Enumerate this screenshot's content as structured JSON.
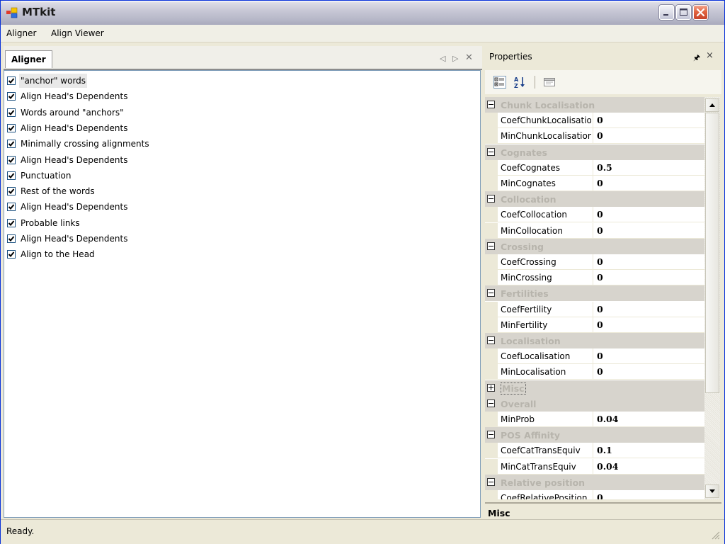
{
  "window": {
    "title": "MTkit"
  },
  "menu": {
    "items": [
      "Aligner",
      "Align Viewer"
    ]
  },
  "left_panel": {
    "tab_label": "Aligner",
    "steps": [
      {
        "label": "\"anchor\" words",
        "checked": true
      },
      {
        "label": "Align Head's Dependents",
        "checked": true
      },
      {
        "label": "Words around \"anchors\"",
        "checked": true
      },
      {
        "label": "Align Head's Dependents",
        "checked": true
      },
      {
        "label": "Minimally crossing alignments",
        "checked": true
      },
      {
        "label": "Align Head's Dependents",
        "checked": true
      },
      {
        "label": "Punctuation",
        "checked": true
      },
      {
        "label": "Rest of the words",
        "checked": true
      },
      {
        "label": "Align Head's Dependents",
        "checked": true
      },
      {
        "label": "Probable links",
        "checked": true
      },
      {
        "label": "Align Head's Dependents",
        "checked": true
      },
      {
        "label": "Align to the Head",
        "checked": true
      }
    ]
  },
  "properties": {
    "title": "Properties",
    "categories": [
      {
        "name": "Chunk Localisation",
        "expanded": true,
        "props": [
          {
            "name": "CoefChunkLocalisation",
            "value": "0"
          },
          {
            "name": "MinChunkLocalisation",
            "value": "0"
          }
        ]
      },
      {
        "name": "Cognates",
        "expanded": true,
        "props": [
          {
            "name": "CoefCognates",
            "value": "0.5"
          },
          {
            "name": "MinCognates",
            "value": "0"
          }
        ]
      },
      {
        "name": "Collocation",
        "expanded": true,
        "props": [
          {
            "name": "CoefCollocation",
            "value": "0"
          },
          {
            "name": "MinCollocation",
            "value": "0"
          }
        ]
      },
      {
        "name": "Crossing",
        "expanded": true,
        "props": [
          {
            "name": "CoefCrossing",
            "value": "0"
          },
          {
            "name": "MinCrossing",
            "value": "0"
          }
        ]
      },
      {
        "name": "Fertilities",
        "expanded": true,
        "props": [
          {
            "name": "CoefFertility",
            "value": "0"
          },
          {
            "name": "MinFertility",
            "value": "0"
          }
        ]
      },
      {
        "name": "Localisation",
        "expanded": true,
        "props": [
          {
            "name": "CoefLocalisation",
            "value": "0"
          },
          {
            "name": "MinLocalisation",
            "value": "0"
          }
        ]
      },
      {
        "name": "Misc",
        "expanded": false,
        "focused": true,
        "props": []
      },
      {
        "name": "Overall",
        "expanded": true,
        "props": [
          {
            "name": "MinProb",
            "value": "0.04"
          }
        ]
      },
      {
        "name": "POS Affinity",
        "expanded": true,
        "props": [
          {
            "name": "CoefCatTransEquiv",
            "value": "0.1"
          },
          {
            "name": "MinCatTransEquiv",
            "value": "0.04"
          }
        ]
      },
      {
        "name": "Relative position",
        "expanded": true,
        "props": [
          {
            "name": "CoefRelativePosition",
            "value": "0"
          }
        ]
      }
    ],
    "description_title": "Misc"
  },
  "status": {
    "text": "Ready."
  }
}
